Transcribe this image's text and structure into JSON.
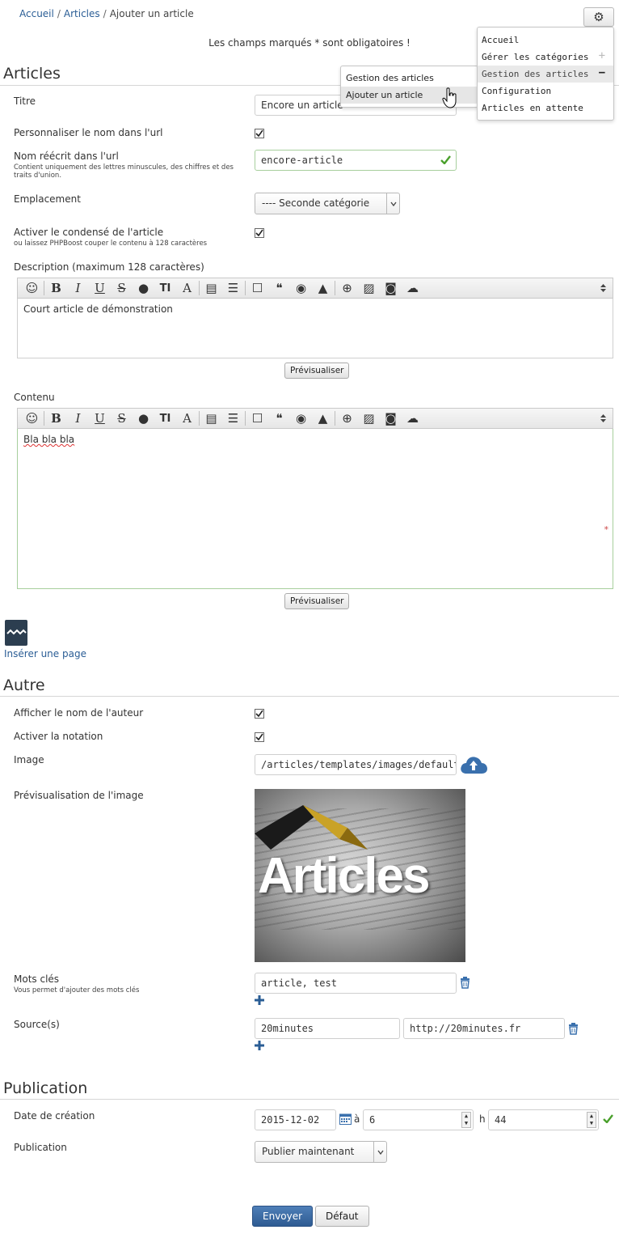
{
  "breadcrumb": {
    "items": [
      "Accueil",
      "Articles"
    ],
    "current": "Ajouter un article",
    "separator": "/"
  },
  "required_note": "Les champs marqués * sont obligatoires !",
  "menu": {
    "items": [
      {
        "label": "Accueil",
        "mark": ""
      },
      {
        "label": "Gérer les catégories",
        "mark": "+"
      },
      {
        "label": "Gestion des articles",
        "mark": "−"
      },
      {
        "label": "Configuration",
        "mark": ""
      },
      {
        "label": "Articles en attente",
        "mark": ""
      }
    ],
    "submenu": [
      "Gestion des articles",
      "Ajouter un article"
    ]
  },
  "articles": {
    "title": "Articles",
    "titre_label": "Titre",
    "titre_value": "Encore un article",
    "personalize_label": "Personnaliser le nom dans l'url",
    "url_label": "Nom réécrit dans l'url",
    "url_help": "Contient uniquement des lettres minuscules, des chiffres et des traits d'union.",
    "url_value": "encore-article",
    "location_label": "Emplacement",
    "location_value": "---- Seconde catégorie",
    "summary_label": "Activer le condensé de l'article",
    "summary_help": "ou laissez PHPBoost couper le contenu à 128 caractères",
    "description_label": "Description (maximum 128 caractères)",
    "description_value": "Court article de démonstration",
    "preview_label": "Prévisualiser",
    "content_label": "Contenu",
    "content_value": "Bla bla bla",
    "required_star": "*",
    "insert_page": "Insérer une page"
  },
  "toolbar": {
    "icons": [
      "smiley-icon",
      "bold-icon",
      "italic-icon",
      "underline-icon",
      "strike-icon",
      "color-icon",
      "size-icon",
      "font-icon",
      "align-icon",
      "list-icon",
      "block-icon",
      "quote-icon",
      "hide-icon",
      "warning-icon",
      "url-icon",
      "image-icon",
      "camera-icon",
      "upload-icon"
    ],
    "glyphs": [
      "☺",
      "B",
      "I",
      "U",
      "S",
      "●",
      "TI",
      "A",
      "▤",
      "☰",
      "☐",
      "❝",
      "◉",
      "▲",
      "⊕",
      "▨",
      "◙",
      "☁"
    ]
  },
  "autre": {
    "title": "Autre",
    "author_label": "Afficher le nom de l'auteur",
    "notation_label": "Activer la notation",
    "image_label": "Image",
    "image_value": "/articles/templates/images/default.p",
    "image_preview_label": "Prévisualisation de l'image",
    "image_preview_text": "Articles",
    "keywords_label": "Mots clés",
    "keywords_help": "Vous permet d'ajouter des mots clés",
    "keywords_value": "article, test",
    "sources_label": "Source(s)",
    "source_name": "20minutes",
    "source_url": "http://20minutes.fr"
  },
  "publication": {
    "title": "Publication",
    "date_label": "Date de création",
    "date_value": "2015-12-02",
    "at_label": "à",
    "hour_value": "6",
    "h_label": "h",
    "minute_value": "44",
    "publication_label": "Publication",
    "publication_value": "Publier maintenant"
  },
  "buttons": {
    "submit": "Envoyer",
    "reset": "Défaut"
  },
  "colors": {
    "link": "#2a5d95",
    "ok": "#4aa02c",
    "primary": "#2e5b92",
    "required": "#c44"
  }
}
